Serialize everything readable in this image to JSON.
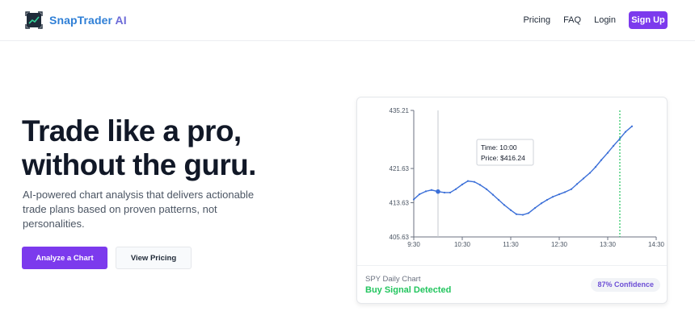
{
  "nav": {
    "brand_name": "SnapTrader",
    "brand_suffix": "AI",
    "links": [
      "Pricing",
      "FAQ",
      "Login"
    ],
    "signup_label": "Sign Up",
    "logo_icon": "chart-frame-logo-icon",
    "accent_color": "#7c3aed"
  },
  "hero": {
    "title_line1": "Trade like a pro,",
    "title_line2": "without the guru.",
    "subtitle": "AI-powered chart analysis that delivers actionable trade plans based on proven patterns, not personalities.",
    "primary_cta": "Analyze a Chart",
    "secondary_cta": "View Pricing"
  },
  "card": {
    "chart_name": "SPY Daily Chart",
    "signal": "Buy Signal Detected",
    "signal_color": "#22c55e",
    "confidence": "87% Confidence"
  },
  "chart_data": {
    "type": "line",
    "x": [
      "9:30",
      "9:37",
      "9:45",
      "9:52",
      "10:00",
      "10:08",
      "10:15",
      "10:22",
      "10:30",
      "10:37",
      "10:45",
      "10:52",
      "11:00",
      "11:08",
      "11:15",
      "11:22",
      "11:30",
      "11:37",
      "11:45",
      "11:52",
      "12:00",
      "12:08",
      "12:15",
      "12:22",
      "12:30",
      "12:37",
      "12:45",
      "12:52",
      "13:00",
      "13:08",
      "13:15",
      "13:22",
      "13:30",
      "13:37",
      "13:45",
      "13:52",
      "14:00",
      "14:08",
      "14:15"
    ],
    "series": [
      {
        "color": "#3b6fd8",
        "values": [
          414.4,
          415.6,
          416.3,
          416.6,
          416.24,
          416.0,
          416.0,
          416.8,
          417.9,
          418.7,
          418.5,
          417.8,
          416.8,
          415.5,
          414.3,
          413.1,
          411.9,
          410.95,
          410.8,
          411.2,
          412.4,
          413.5,
          414.3,
          415.0,
          415.6,
          416.1,
          416.8,
          418.0,
          419.3,
          420.6,
          422.0,
          423.6,
          425.3,
          426.9,
          428.6,
          430.2,
          431.5
        ]
      }
    ],
    "yticks": [
      435.21,
      421.63,
      413.63,
      405.63
    ],
    "xticks": [
      "9:30",
      "10:30",
      "11:30",
      "12:30",
      "13:30",
      "14:30"
    ],
    "ylim": [
      405.63,
      435.21
    ],
    "highlight_point": {
      "time": "10:00",
      "price": 416.24
    },
    "signal_line_time": "13:45",
    "grid": "vertical-line-at-hover",
    "tooltip": {
      "time_label": "Time: 10:00",
      "price_label": "Price: $416.24"
    }
  }
}
